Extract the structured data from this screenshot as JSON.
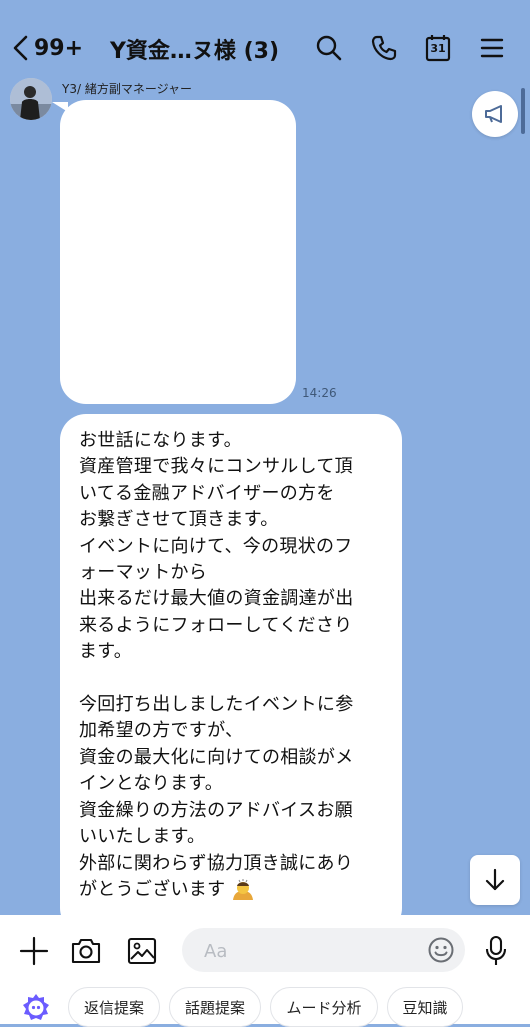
{
  "header": {
    "unread_count": "99+",
    "title": "Y資金…ヌ様 (3)",
    "calendar_day": "31"
  },
  "message1": {
    "sender": "Y3/ 緒方副マネージャー",
    "time": "14:26"
  },
  "message2": {
    "lines": [
      "お世話になります。",
      "資産管理で我々にコンサルして頂",
      "いてる金融アドバイザーの方を",
      "お繋ぎさせて頂きます。",
      "イベントに向けて、今の現状のフ",
      "ォーマットから",
      "出来るだけ最大値の資金調達が出",
      "来るようにフォローしてくださり",
      "ます。",
      "",
      "今回打ち出しましたイベントに参",
      "加希望の方ですが、",
      "資金の最大化に向けての相談がメ",
      "インとなります。",
      "資金繰りの方法のアドバイスお願",
      "いいたします。",
      "外部に関わらず協力頂き誠にあり",
      "がとうございます"
    ]
  },
  "composer": {
    "placeholder": "Aa"
  },
  "suggestions": [
    "返信提案",
    "話題提案",
    "ムード分析",
    "豆知識"
  ],
  "colors": {
    "background": "#8aaee0",
    "bubble": "#ffffff",
    "ai_accent": "#6b5cff"
  },
  "icons": [
    "back-icon",
    "search-icon",
    "phone-icon",
    "calendar-icon",
    "menu-icon",
    "megaphone-icon",
    "arrow-down-icon",
    "plus-icon",
    "camera-icon",
    "image-icon",
    "emoji-icon",
    "mic-icon",
    "ai-assistant-icon",
    "bowing-emoji"
  ]
}
